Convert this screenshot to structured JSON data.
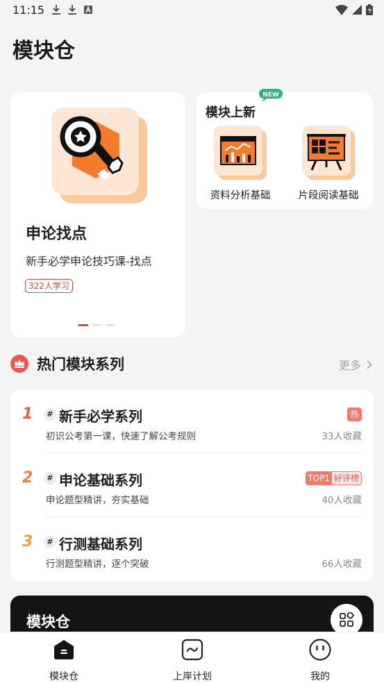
{
  "status_bar": {
    "time": "11:15"
  },
  "page": {
    "title": "模块仓"
  },
  "feature": {
    "title": "申论找点",
    "description": "新手必学申论技巧课-找点",
    "badge": "322人学习"
  },
  "new_modules": {
    "title": "模块上新",
    "tag": "NEW",
    "items": [
      {
        "label": "资料分析基础"
      },
      {
        "label": "片段阅读基础"
      }
    ]
  },
  "hot_section": {
    "title": "热门模块系列",
    "more": "更多"
  },
  "series": [
    {
      "rank": "1",
      "name": "新手必学系列",
      "description": "初识公考第一课，快速了解公考规则",
      "count": "33人收藏",
      "badge": "热",
      "rank_color": "#e9584c"
    },
    {
      "rank": "2",
      "name": "申论基础系列",
      "description": "申论题型精讲，夯实基础",
      "count": "40人收藏",
      "badge_a": "TOP1",
      "badge_b": "好评榜",
      "rank_color": "#ef7d43"
    },
    {
      "rank": "3",
      "name": "行测基础系列",
      "description": "行测题型精讲，逐个突破",
      "count": "66人收藏",
      "rank_color": "#f0a13a"
    }
  ],
  "banner": {
    "title": "模块仓"
  },
  "tabs": [
    {
      "label": "模块仓"
    },
    {
      "label": "上岸计划"
    },
    {
      "label": "我的"
    }
  ],
  "colors": {
    "accent": "#e9584c",
    "brand_orange": "#fbcfa6"
  }
}
